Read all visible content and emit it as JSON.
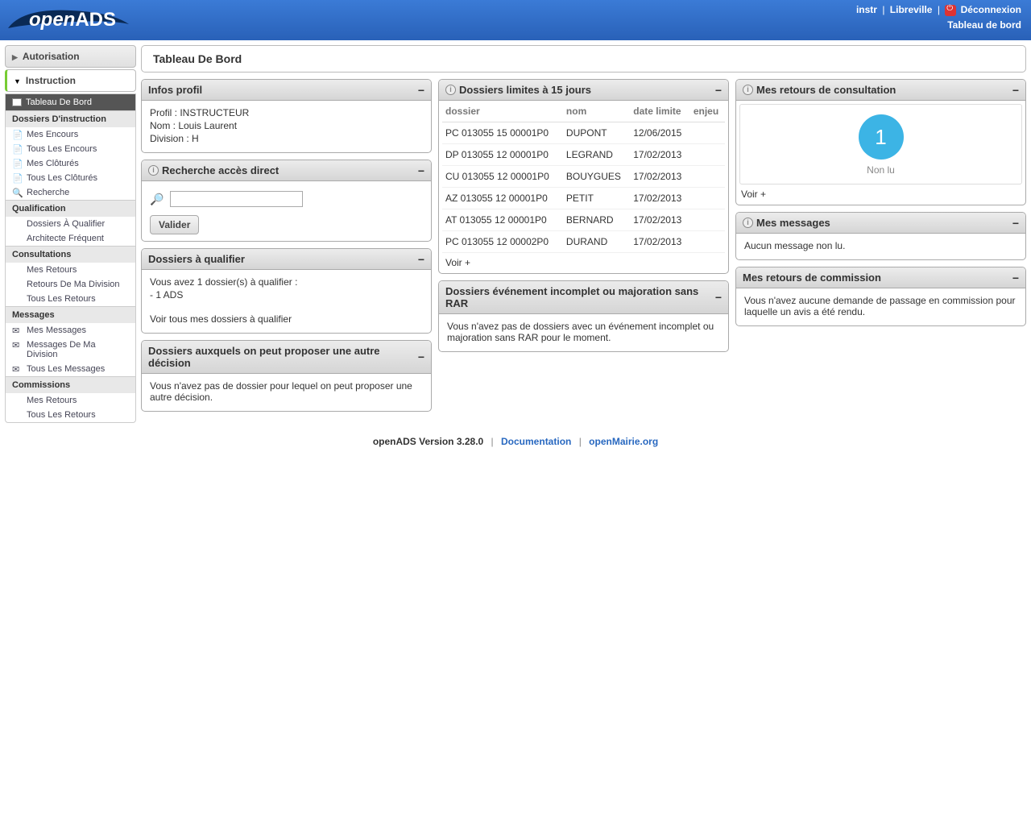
{
  "logo": {
    "text_open": "open",
    "text_ads": "ADS"
  },
  "header": {
    "user": "instr",
    "city": "Libreville",
    "logout": "Déconnexion",
    "dashboard": "Tableau de bord"
  },
  "sidebar": {
    "autorisation": "Autorisation",
    "instruction": "Instruction",
    "tableau_de_bord": "Tableau De Bord",
    "groups": {
      "dossiers_instruction": "Dossiers D'instruction",
      "qualification": "Qualification",
      "consultations": "Consultations",
      "messages": "Messages",
      "commissions": "Commissions"
    },
    "items": {
      "mes_encours": "Mes Encours",
      "tous_encours": "Tous Les Encours",
      "mes_clotures": "Mes Clôturés",
      "tous_clotures": "Tous Les Clôturés",
      "recherche": "Recherche",
      "dossiers_qualifier": "Dossiers À Qualifier",
      "architecte_frequent": "Architecte Fréquent",
      "mes_retours": "Mes Retours",
      "retours_division": "Retours De Ma Division",
      "tous_retours": "Tous Les Retours",
      "mes_messages": "Mes Messages",
      "messages_division": "Messages De Ma Division",
      "tous_messages": "Tous Les Messages",
      "mes_retours_comm": "Mes Retours",
      "tous_retours_comm": "Tous Les Retours"
    }
  },
  "page_title": "Tableau De Bord",
  "widgets": {
    "profil": {
      "title": "Infos profil",
      "profil_label": "Profil : INSTRUCTEUR",
      "nom_label": "Nom : Louis Laurent",
      "division_label": "Division : H"
    },
    "recherche": {
      "title": "Recherche accès direct",
      "button": "Valider"
    },
    "qualifier": {
      "title": "Dossiers à qualifier",
      "line1": "Vous avez 1 dossier(s) à qualifier :",
      "line2": "- 1 ADS",
      "link": "Voir tous mes dossiers à qualifier"
    },
    "autre_decision": {
      "title": "Dossiers auxquels on peut proposer une autre décision",
      "body": "Vous n'avez pas de dossier pour lequel on peut proposer une autre décision."
    },
    "limites": {
      "title": "Dossiers limites à 15 jours",
      "th_dossier": "dossier",
      "th_nom": "nom",
      "th_date": "date limite",
      "th_enjeu": "enjeu",
      "rows": [
        {
          "d": "PC 013055 15 00001P0",
          "n": "DUPONT",
          "dl": "12/06/2015"
        },
        {
          "d": "DP 013055 12 00001P0",
          "n": "LEGRAND",
          "dl": "17/02/2013"
        },
        {
          "d": "CU 013055 12 00001P0",
          "n": "BOUYGUES",
          "dl": "17/02/2013"
        },
        {
          "d": "AZ 013055 12 00001P0",
          "n": "PETIT",
          "dl": "17/02/2013"
        },
        {
          "d": "AT 013055 12 00001P0",
          "n": "BERNARD",
          "dl": "17/02/2013"
        },
        {
          "d": "PC 013055 12 00002P0",
          "n": "DURAND",
          "dl": "17/02/2013"
        }
      ],
      "voir": "Voir +"
    },
    "incomplet": {
      "title": "Dossiers événement incomplet ou majoration sans RAR",
      "body": "Vous n'avez pas de dossiers avec un événement incomplet ou majoration sans RAR pour le moment."
    },
    "consultation": {
      "title": "Mes retours de consultation",
      "count": "1",
      "nonlu": "Non lu",
      "voir": "Voir +"
    },
    "messages": {
      "title": "Mes messages",
      "body": "Aucun message non lu."
    },
    "commission": {
      "title": "Mes retours de commission",
      "body": "Vous n'avez aucune demande de passage en commission pour laquelle un avis a été rendu."
    }
  },
  "footer": {
    "version": "openADS Version 3.28.0",
    "doc": "Documentation",
    "om": "openMairie.org"
  }
}
